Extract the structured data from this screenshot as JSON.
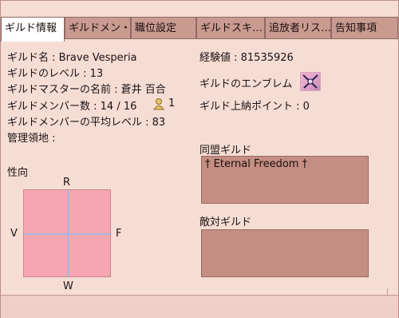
{
  "tabs": [
    {
      "label": "ギルド情報"
    },
    {
      "label": "ギルドメン・"
    },
    {
      "label": "職位設定"
    },
    {
      "label": "ギルドスキ…"
    },
    {
      "label": "追放者リス…"
    },
    {
      "label": "告知事項"
    }
  ],
  "info": {
    "guild_name": "ギルド名 : Brave Vesperia",
    "guild_level": "ギルドのレベル : 13",
    "master_name": "ギルドマスターの名前 : 蒼井 百合",
    "member_count": "ギルドメンバー数 : 14 / 16",
    "online_count": "1",
    "average_level": "ギルドメンバーの平均レベル : 83",
    "territory": "管理領地 :",
    "experience": "経験値 : 81535926",
    "emblem_label": "ギルドのエンブレム",
    "tribute_points": "ギルド上納ポイント : 0"
  },
  "alliance": {
    "label": "同盟ギルド",
    "entries": [
      "† Eternal Freedom †"
    ]
  },
  "hostile": {
    "label": "敵対ギルド"
  },
  "alignment": {
    "label": "性向",
    "top": "R",
    "bottom": "W",
    "left": "V",
    "right": "F"
  },
  "icons": {
    "emblem": "guild-emblem-icon",
    "member": "member-person-icon"
  }
}
